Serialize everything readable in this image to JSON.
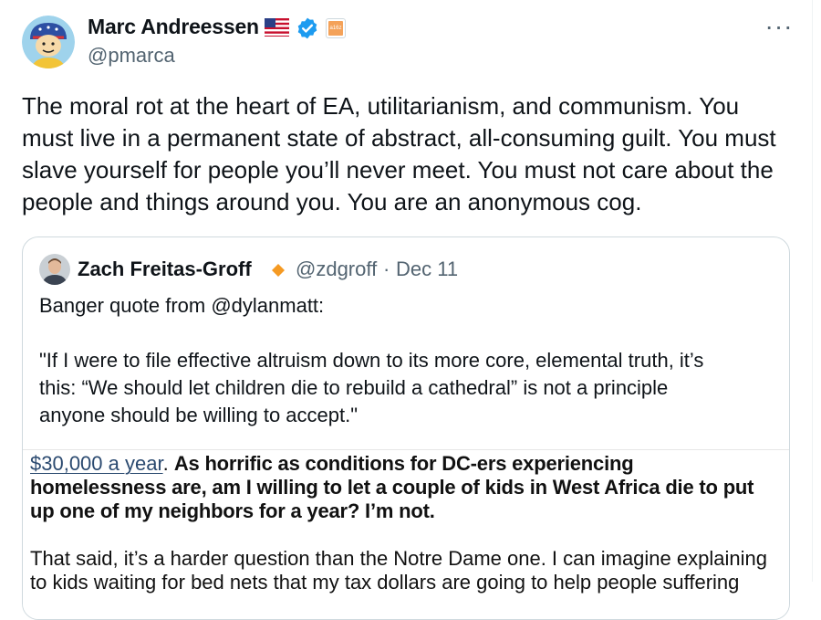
{
  "author": {
    "name": "Marc Andreessen",
    "handle": "@pmarca",
    "affiliation_badge": "a16z"
  },
  "icons": [
    "flag-icon",
    "verified-icon",
    "more-icon",
    "diamond-icon"
  ],
  "colors": {
    "verified": "#1d9bf0",
    "handle": "#536471",
    "link": "#2b4a70",
    "diamond": "#f59a23"
  },
  "more_label": "···",
  "tweet": {
    "lines": [
      "The moral rot at the heart of EA, utilitarianism, and communism. You",
      "must live in a permanent state of abstract, all-consuming guilt. You must",
      "slave yourself for people you’ll never meet. You must not care about the",
      "people and things around you. You are an anonymous cog."
    ]
  },
  "quote": {
    "name": "Zach Freitas-Groff",
    "handle": "@zdgroff",
    "separator": "·",
    "date": "Dec 11",
    "line1": "Banger quote from @dylanmatt:",
    "body_lines": [
      "\"If I were to file effective altruism down to its more core, elemental truth, it’s",
      "this: “We should let children die to rebuild a cathedral” is not a principle",
      "anyone should be willing to accept.\""
    ],
    "embed": {
      "link_text": "$30,000 a year",
      "link_after": ". ",
      "bold_1": "As horrific as conditions for DC-ers experiencing",
      "bold_2": "homelessness are, am I willing to let a couple of kids in West Africa die to put",
      "bold_3": "up one of my neighbors for a year? I’m not.",
      "line_4": "That said, it’s a harder question than the Notre Dame one. I can imagine explaining",
      "line_5": "to kids waiting for bed nets that my tax dollars are going to help people suffering"
    }
  }
}
